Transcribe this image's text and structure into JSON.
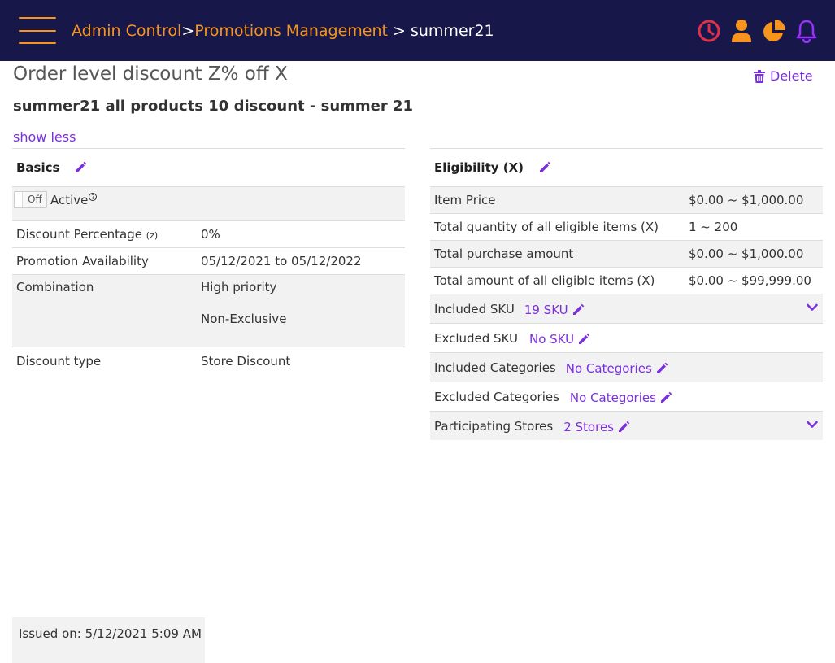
{
  "header": {
    "breadcrumb": {
      "root": "Admin Control",
      "sep1": ">",
      "middle": "Promotions Management",
      "sep2": " > ",
      "current": "summer21"
    },
    "icons": [
      "clock-icon",
      "user-icon",
      "pie-chart-icon",
      "bell-icon"
    ],
    "colors": {
      "bar": "#17174a",
      "accent": "#f7941d",
      "clock": "#e0304a",
      "bell": "#9b30ff"
    }
  },
  "title": {
    "heading": "Order level discount Z% off X",
    "promo_name": "summer21 all products 10 discount - summer 21",
    "delete_label": "Delete",
    "show_less": "show less"
  },
  "basics": {
    "heading": "Basics",
    "toggle_label": "Off",
    "active_label": "Active",
    "help_mark": "?",
    "discount_label": "Discount Percentage",
    "discount_suffix": "(z)",
    "discount_value": "0%",
    "availability_label": "Promotion Availability",
    "availability_value": "05/12/2021 to 05/12/2022",
    "combination_label": "Combination",
    "combination_values": [
      "High priority",
      "Non-Exclusive"
    ],
    "discount_type_label": "Discount type",
    "discount_type_value": "Store Discount"
  },
  "eligibility": {
    "heading": "Eligibility (X)",
    "rows": [
      {
        "label": "Item Price",
        "value": "$0.00 ~ $1,000.00"
      },
      {
        "label": "Total quantity of all eligible items (X)",
        "value": "1 ~ 200"
      },
      {
        "label": "Total purchase amount",
        "value": "$0.00 ~ $1,000.00"
      },
      {
        "label": "Total amount of all eligible items (X)",
        "value": "$0.00 ~ $99,999.00"
      }
    ],
    "included_sku": {
      "label": "Included SKU",
      "value": "19 SKU"
    },
    "excluded_sku": {
      "label": "Excluded SKU",
      "value": "No SKU"
    },
    "included_categories": {
      "label": "Included Categories",
      "value": "No Categories"
    },
    "excluded_categories": {
      "label": "Excluded Categories",
      "value": "No Categories"
    },
    "participating_stores": {
      "label": "Participating Stores",
      "value": "2 Stores"
    }
  },
  "footer": {
    "issued": "Issued on: 5/12/2021 5:09 AM"
  }
}
